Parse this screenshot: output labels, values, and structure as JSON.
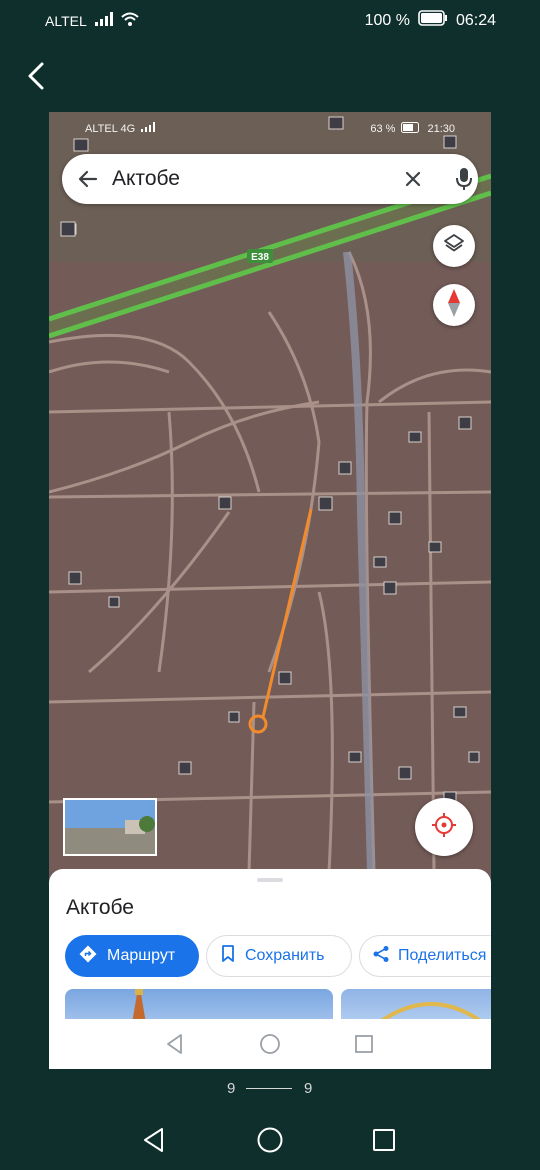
{
  "status_bar": {
    "carrier": "ALTEL",
    "battery": "100 %",
    "time": "06:24"
  },
  "screenshot": {
    "inner_status": {
      "carrier": "ALTEL 4G",
      "battery": "63 %",
      "time": "21:30"
    },
    "search": {
      "query": "Актобе"
    },
    "map": {
      "road_label": "E38",
      "road_color": "#5fbf4a",
      "route_color": "#f28b2c"
    },
    "place": {
      "title": "Актобе",
      "actions": [
        {
          "label": "Маршрут"
        },
        {
          "label": "Сохранить"
        },
        {
          "label": "Поделиться"
        }
      ]
    }
  },
  "pager": {
    "current": "9",
    "total": "9"
  },
  "colors": {
    "background": "#0f2f2c",
    "accent": "#1a73e8"
  },
  "icons": [
    "back-icon",
    "signal-icon",
    "wifi-icon",
    "battery-icon",
    "layers-icon",
    "compass-icon",
    "locate-icon",
    "mic-icon",
    "clear-icon",
    "directions-icon",
    "bookmark-icon",
    "share-icon",
    "nav-back-icon",
    "nav-home-icon",
    "nav-recents-icon"
  ]
}
